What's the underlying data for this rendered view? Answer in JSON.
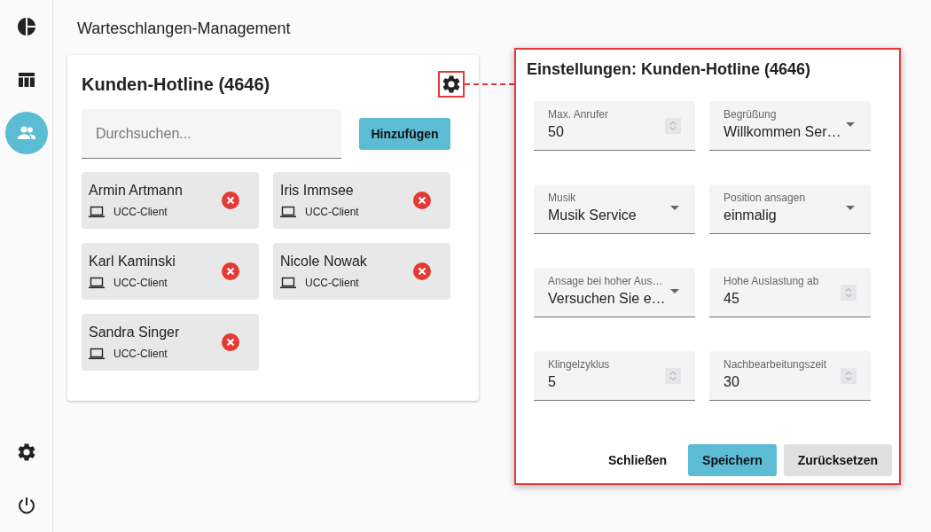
{
  "sidebar": {
    "items": [
      {
        "selected": false
      },
      {
        "selected": false
      },
      {
        "selected": true
      }
    ],
    "bottom_items": [
      {
        "selected": false
      },
      {
        "selected": false
      }
    ]
  },
  "page_title": "Warteschlangen-Management",
  "queue_card": {
    "title": "Kunden-Hotline (4646)",
    "settings_highlighted": true,
    "search": {
      "placeholder": "Durchsuchen..."
    },
    "add_button": "Hinzufügen",
    "agents": [
      {
        "name": "Armin Artmann",
        "client": "UCC-Client"
      },
      {
        "name": "Iris Immsee",
        "client": "UCC-Client"
      },
      {
        "name": "Karl Kaminski",
        "client": "UCC-Client"
      },
      {
        "name": "Nicole Nowak",
        "client": "UCC-Client"
      },
      {
        "name": "Sandra Singer",
        "client": "UCC-Client"
      }
    ]
  },
  "settings_dialog": {
    "title": "Einstellungen: Kunden-Hotline (4646)",
    "fields": [
      {
        "kind": "number",
        "label": "Max. Anrufer",
        "value": "50"
      },
      {
        "kind": "select",
        "label": "Begrüßung",
        "value": "Willkommen Ser…"
      },
      {
        "kind": "select",
        "label": "Musik",
        "value": "Musik Service"
      },
      {
        "kind": "select",
        "label": "Position ansagen",
        "value": "einmalig"
      },
      {
        "kind": "select",
        "label": "Ansage bei hoher Aus…",
        "value": "Versuchen Sie e…"
      },
      {
        "kind": "number",
        "label": "Hohe Auslastung ab",
        "value": "45"
      },
      {
        "kind": "number",
        "label": "Klingelzyklus",
        "value": "5"
      },
      {
        "kind": "number",
        "label": "Nachbearbeitungszeit",
        "value": "30"
      }
    ],
    "buttons": [
      {
        "label": "Schließen",
        "kind": "text"
      },
      {
        "label": "Speichern",
        "kind": "primary"
      },
      {
        "label": "Zurücksetzen",
        "kind": "secondary"
      }
    ]
  }
}
